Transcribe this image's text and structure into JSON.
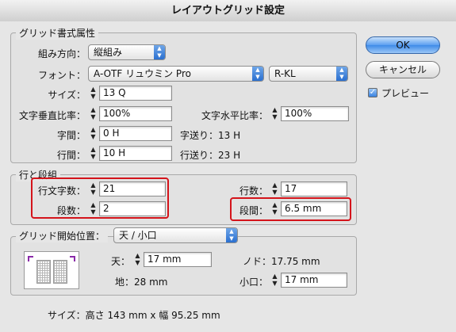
{
  "window": {
    "title": "レイアウトグリッド設定"
  },
  "buttons": {
    "ok": "OK",
    "cancel": "キャンセル",
    "preview": "プレビュー"
  },
  "grid_format": {
    "legend": "グリッド書式属性",
    "direction": {
      "label": "組み方向：",
      "value": "縦組み"
    },
    "font": {
      "label": "フォント：",
      "family": "A-OTF リュウミン Pro",
      "style": "R-KL"
    },
    "size": {
      "label": "サイズ：",
      "value": "13 Q"
    },
    "vscale": {
      "label": "文字垂直比率：",
      "value": "100%"
    },
    "hscale": {
      "label": "文字水平比率：",
      "value": "100%"
    },
    "char_spacing": {
      "label": "字間：",
      "value": "0 H"
    },
    "char_advance": "字送り：13 H",
    "line_spacing": {
      "label": "行間：",
      "value": "10 H"
    },
    "line_advance": "行送り：23 H"
  },
  "lines_columns": {
    "legend": "行と段組",
    "chars_per_line": {
      "label": "行文字数：",
      "value": "21"
    },
    "lines": {
      "label": "行数：",
      "value": "17"
    },
    "columns": {
      "label": "段数：",
      "value": "2"
    },
    "gutter": {
      "label": "段間：",
      "value": "6.5 mm"
    }
  },
  "grid_start": {
    "label": "グリッド開始位置：",
    "value": "天 / 小口",
    "top": {
      "label": "天：",
      "value": "17 mm"
    },
    "nodo": "ノド：17.75 mm",
    "bottom": "地：28 mm",
    "koguchi": {
      "label": "小口：",
      "value": "17 mm"
    }
  },
  "size_summary": "サイズ：高さ 143 mm x 幅 95.25 mm",
  "colors": {
    "highlight": "#d4141b",
    "accent": "#3f8be8"
  }
}
